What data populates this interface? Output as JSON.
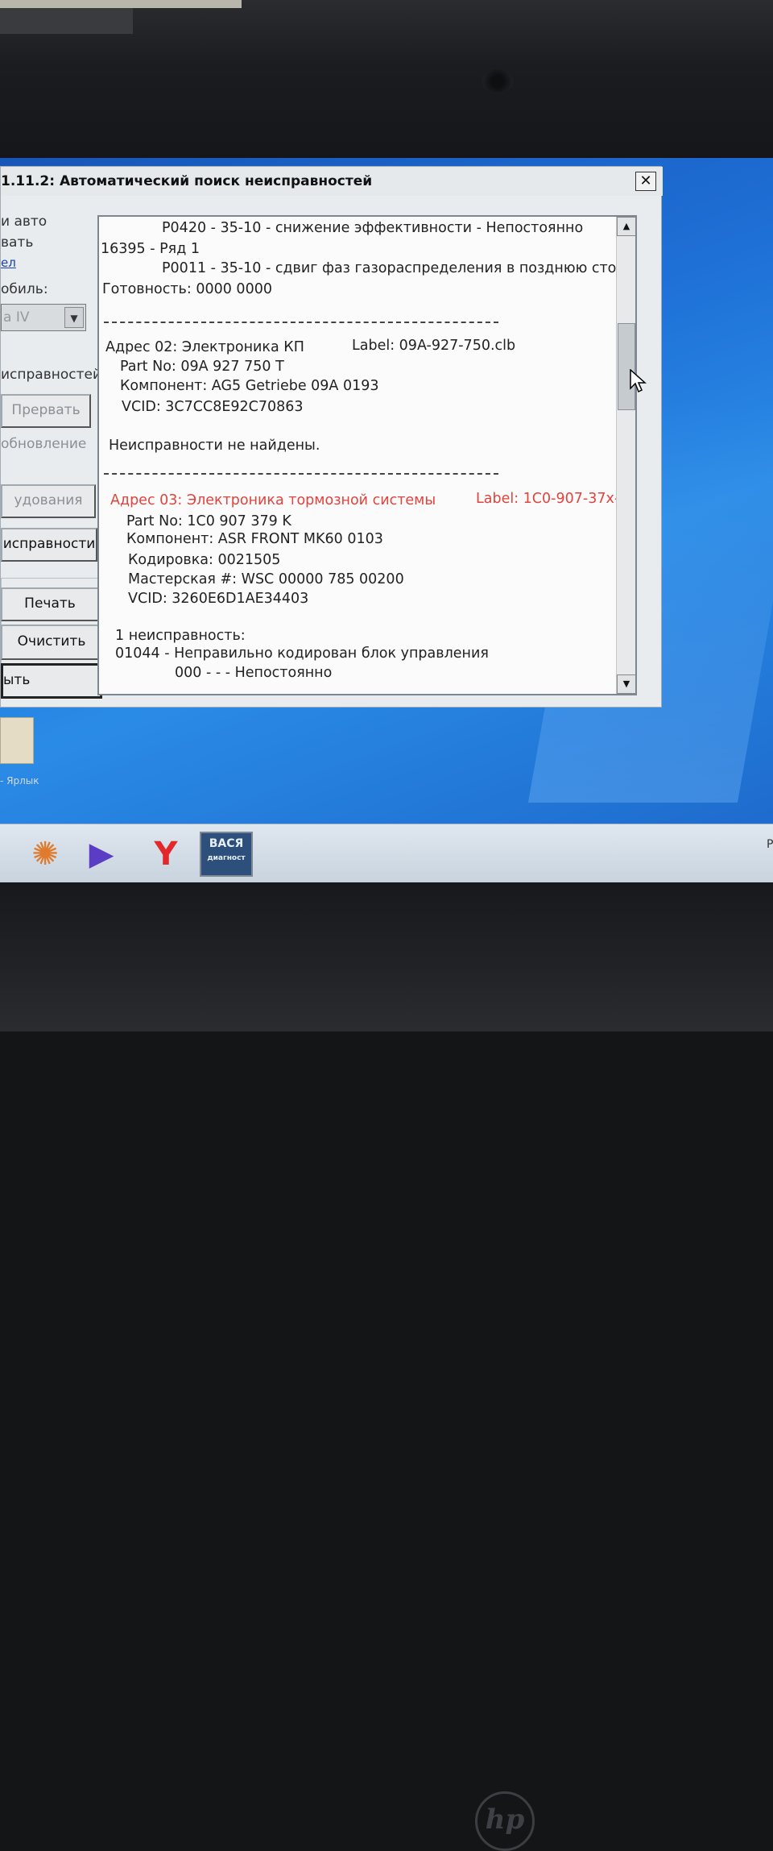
{
  "window": {
    "title": "1.11.2: Автоматический поиск неисправностей",
    "close_glyph": "✕"
  },
  "sidebar": {
    "text_auto": "и авто",
    "text_vat": "вать",
    "link": "ел",
    "vehicle_label": "обиль:",
    "vehicle_value": "а IV",
    "faults_label": "исправностей",
    "btn_abort": "Прервать",
    "update_label": "обновление",
    "btn_equipment": "удования",
    "btn_faults": "исправности",
    "btn_print": "Печать",
    "btn_clear": "Очистить",
    "btn_close": "ыть"
  },
  "report": {
    "lines": [
      "P0420 - 35-10 - снижение эффективности - Непостоянно",
      "16395 - Ряд 1",
      "P0011 - 35-10 - сдвиг фаз газораспределения в позднюю сто",
      "Готовность: 0000 0000",
      "Адрес 02:  Электроника КП",
      "Label: 09A-927-750.clb",
      "Part No: 09A 927 750 T",
      "Компонент: AG5 Getriebe 09A   0193",
      "VCID: 3C7CC8E92C70863",
      "Неисправности не найдены.",
      "Адрес 03:  Электроника тормозной системы",
      "Label: 1C0-907-37x-",
      "Part No: 1C0 907 379 K",
      "Компонент: ASR FRONT MK60      0103",
      "Кодировка: 0021505",
      "Мастерская #: WSC 00000 785 00200",
      "VCID: 3260E6D1AE34403",
      "1 неисправность:",
      "01044 - Неправильно кодирован блок управления",
      "000 -  -  - Непостоянно"
    ]
  },
  "taskbar": {
    "vasya_label": "ВАСЯ",
    "vasya_sub": "диагност",
    "tray_letter": "Р"
  },
  "desktop": {
    "shortcut_label": "- Ярлык"
  }
}
